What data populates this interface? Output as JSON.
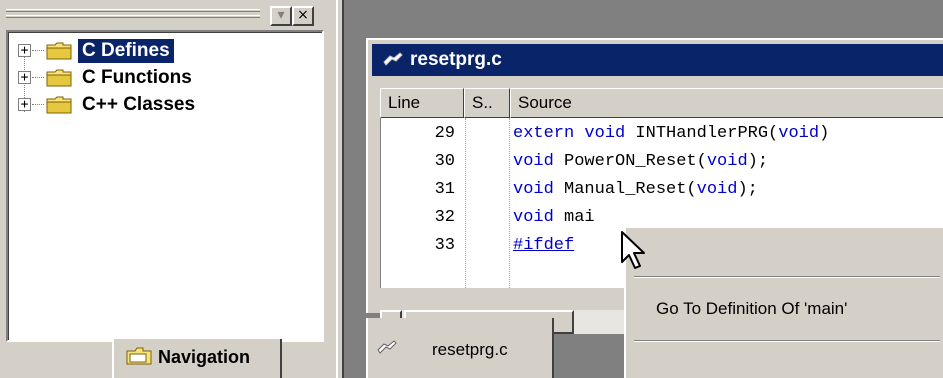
{
  "nav_pane": {
    "toolbar": {
      "dropdown_glyph": "▾",
      "close_glyph": "×"
    },
    "tree_items": [
      {
        "label": "C Defines",
        "expander": "+",
        "icon": "folder-icon",
        "selected": true
      },
      {
        "label": "C Functions",
        "expander": "+",
        "icon": "folder-icon",
        "selected": false
      },
      {
        "label": "C++ Classes",
        "expander": "+",
        "icon": "folder-icon",
        "selected": false
      }
    ],
    "tab": {
      "label": "Navigation",
      "icon": "folder-tab-icon"
    }
  },
  "editor": {
    "title": "resetprg.c",
    "columns": [
      "Line",
      "S..",
      "Source"
    ],
    "lines": [
      {
        "number": "29",
        "tokens": [
          {
            "t": "extern void ",
            "c": "kw"
          },
          {
            "t": "INTHandlerPRG(",
            "c": "plain"
          },
          {
            "t": "void",
            "c": "kw"
          },
          {
            "t": ")",
            "c": "plain"
          }
        ]
      },
      {
        "number": "30",
        "tokens": [
          {
            "t": "void ",
            "c": "kw"
          },
          {
            "t": "PowerON_Reset(",
            "c": "plain"
          },
          {
            "t": "void",
            "c": "kw"
          },
          {
            "t": ");",
            "c": "plain"
          }
        ]
      },
      {
        "number": "31",
        "tokens": [
          {
            "t": "void ",
            "c": "kw"
          },
          {
            "t": "Manual_Reset(",
            "c": "plain"
          },
          {
            "t": "void",
            "c": "kw"
          },
          {
            "t": ");",
            "c": "plain"
          }
        ]
      },
      {
        "number": "32",
        "tokens": [
          {
            "t": "void ",
            "c": "kw"
          },
          {
            "t": "mai",
            "c": "plain"
          }
        ]
      },
      {
        "number": "33",
        "tokens": [
          {
            "t": "#ifdef",
            "c": "pp"
          }
        ]
      }
    ],
    "scroll_left_glyph": "◀",
    "tab_label": "resetprg.c"
  },
  "context_menu": {
    "items": [
      "Go To Definition Of 'main'"
    ]
  },
  "colors": {
    "selection": "#0a246a",
    "keyword": "#0000cc",
    "window_face": "#d4d0c8",
    "mdi_background": "#808080"
  }
}
